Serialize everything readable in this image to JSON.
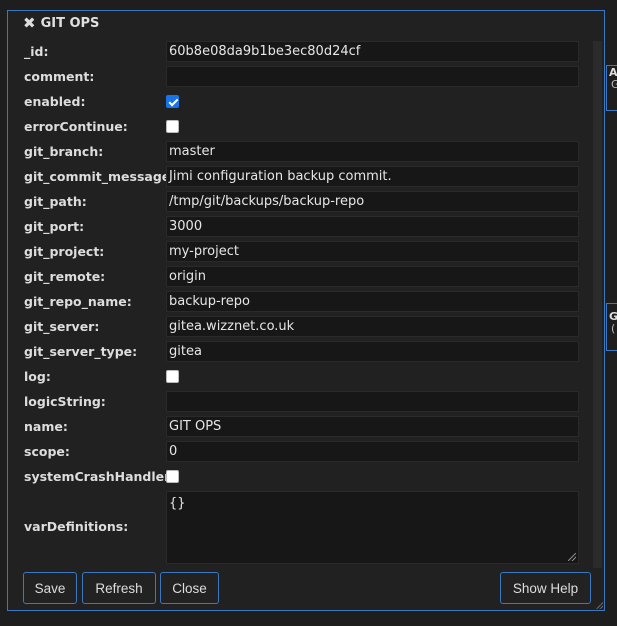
{
  "background_nodes": [
    {
      "title": "AL",
      "subtitle": "G"
    },
    {
      "title": "G",
      "subtitle": "("
    }
  ],
  "dialog": {
    "title": "GIT OPS",
    "properties": [
      {
        "label": "_id:",
        "type": "text",
        "value": "60b8e08da9b1be3ec80d24cf"
      },
      {
        "label": "comment:",
        "type": "text",
        "value": ""
      },
      {
        "label": "enabled:",
        "type": "checkbox",
        "checked": true
      },
      {
        "label": "errorContinue:",
        "type": "checkbox",
        "checked": false
      },
      {
        "label": "git_branch:",
        "type": "text",
        "value": "master"
      },
      {
        "label": "git_commit_message:",
        "type": "text",
        "value": "Jimi configuration backup commit."
      },
      {
        "label": "git_path:",
        "type": "text",
        "value": "/tmp/git/backups/backup-repo"
      },
      {
        "label": "git_port:",
        "type": "text",
        "value": "3000"
      },
      {
        "label": "git_project:",
        "type": "text",
        "value": "my-project"
      },
      {
        "label": "git_remote:",
        "type": "text",
        "value": "origin"
      },
      {
        "label": "git_repo_name:",
        "type": "text",
        "value": "backup-repo"
      },
      {
        "label": "git_server:",
        "type": "text",
        "value": "gitea.wizznet.co.uk"
      },
      {
        "label": "git_server_type:",
        "type": "text",
        "value": "gitea"
      },
      {
        "label": "log:",
        "type": "checkbox",
        "checked": false
      },
      {
        "label": "logicString:",
        "type": "text",
        "value": ""
      },
      {
        "label": "name:",
        "type": "text",
        "value": "GIT OPS"
      },
      {
        "label": "scope:",
        "type": "text",
        "value": "0"
      },
      {
        "label": "systemCrashHandler:",
        "type": "checkbox",
        "checked": false
      },
      {
        "label": "varDefinitions:",
        "type": "textarea",
        "value": "{}"
      }
    ],
    "buttons": {
      "save": "Save",
      "refresh": "Refresh",
      "close": "Close",
      "help": "Show Help"
    }
  },
  "colors": {
    "accent": "#3a78c2",
    "background": "#1e1e1e",
    "input_bg": "#171717",
    "checkbox_on": "#1a73e8"
  }
}
